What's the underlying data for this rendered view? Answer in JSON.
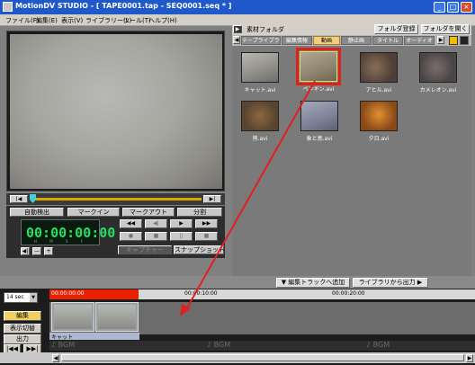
{
  "window": {
    "title": "MotionDV STUDIO - [ TAPE0001.tap - SEQ0001.seq * ]",
    "min_glyph": "_",
    "max_glyph": "□",
    "close_glyph": "×"
  },
  "menu": [
    "ファイル(F)",
    "編集(E)",
    "表示(V)",
    "ライブラリー(L)",
    "ツール(T)",
    "ヘルプ(H)"
  ],
  "seekbar": {
    "left_label": "|◀",
    "right_label": "▶|"
  },
  "controls": {
    "auto_detect": "自動検出",
    "mark_in": "マークイン",
    "mark_out": "マークアウト",
    "split": "分割",
    "timecode": "00:00:00:00",
    "timecode_units": "H M S F",
    "capture": "キャプチャー",
    "snapshot": "スナップショット",
    "rewind": "◀◀",
    "step_back": "◀|",
    "play": "▶",
    "fast_forward": "▶▶",
    "stop": "■",
    "pause": "||",
    "record": "●",
    "small_a": "◀|",
    "small_b": "—",
    "small_c": "+"
  },
  "library": {
    "folder_label": "素材フォルダ",
    "register_folder": "フォルダ登録",
    "open_folder": "フォルダを開く",
    "tabs": [
      "テープライブラリ",
      "編集情報",
      "動画",
      "静止画",
      "タイトル",
      "オーディオ"
    ],
    "active_tab": "動画",
    "clips": [
      {
        "label": "キャット.avi"
      },
      {
        "label": "ペンギン.avi"
      },
      {
        "label": "アヒル.avi"
      },
      {
        "label": "カメレオン.avi"
      },
      {
        "label": "熊.avi"
      },
      {
        "label": "象と鳥.avi"
      },
      {
        "label": "夕日.avi"
      }
    ],
    "selected_index": 1
  },
  "toolbar": {
    "add_to_edit_track": "▼ 編集トラックへ追加",
    "export_from_library": "ライブラリから出力 ▶"
  },
  "timeline": {
    "zoom": "14 sec",
    "edit_button": "編集",
    "display_switch": "表示切替",
    "output": "出力",
    "ruler_marks": [
      "00:00:00:00",
      "00:00:10:00",
      "00:00:20:00"
    ],
    "clip_name": "キャット",
    "bgm_label": "♪ BGM",
    "scroll_first": "|◀◀",
    "scroll_last": "▶▶|"
  },
  "colors": {
    "titlebar": "#1f58c8",
    "selection": "#e02020",
    "timecode": "#28e060",
    "ruler_highlight": "#e82000"
  }
}
